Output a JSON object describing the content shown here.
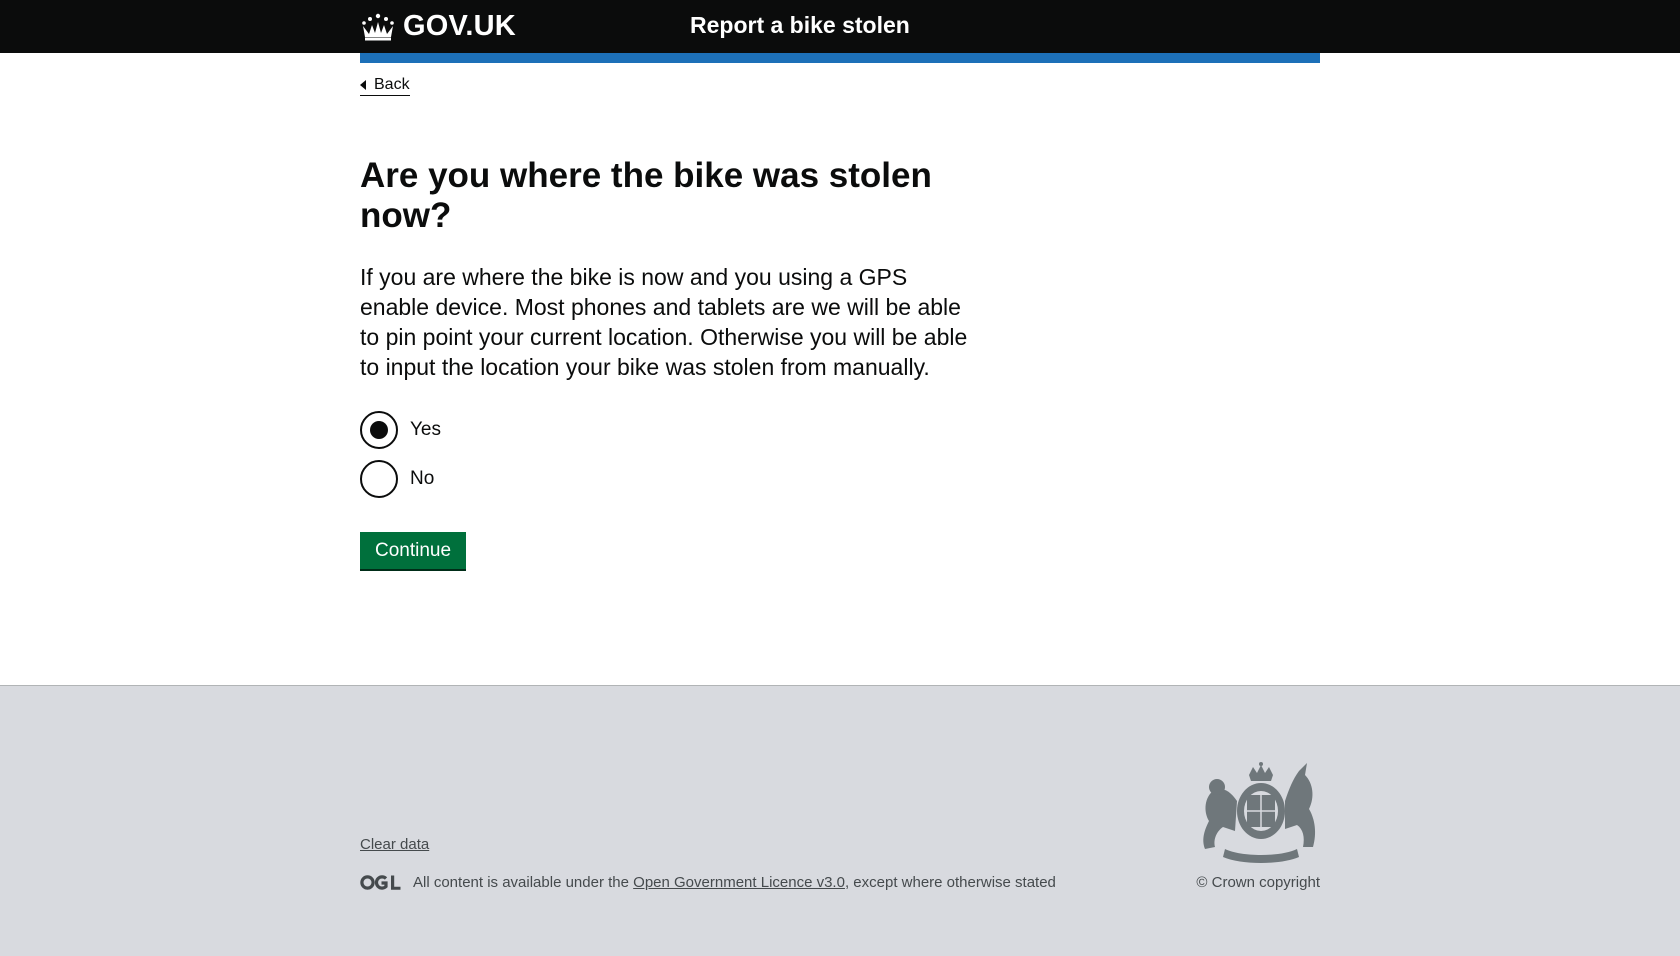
{
  "header": {
    "logo_text": "GOV.UK",
    "service_name": "Report a bike stolen"
  },
  "nav": {
    "back_label": "Back"
  },
  "main": {
    "heading": "Are you where the bike was stolen now?",
    "hint": "If you are where the bike is now and you using a GPS enable device. Most phones and tablets are we will be able to pin point your current location. Otherwise you will be able to input the location your bike was stolen from manually.",
    "options": [
      {
        "label": "Yes",
        "checked": true
      },
      {
        "label": "No",
        "checked": false
      }
    ],
    "continue_label": "Continue"
  },
  "footer": {
    "clear_data_label": "Clear data",
    "licence_prefix": "All content is available under the ",
    "licence_link": "Open Government Licence v3.0",
    "licence_suffix": ", except where otherwise stated",
    "copyright": "© Crown copyright"
  },
  "colors": {
    "header_bg": "#0b0c0c",
    "accent_blue": "#1d70b8",
    "button_green": "#00703c",
    "footer_bg": "#d8dadf"
  },
  "icons": [
    "crown-icon",
    "back-chevron-icon",
    "ogl-logo-icon",
    "royal-crest-icon"
  ]
}
